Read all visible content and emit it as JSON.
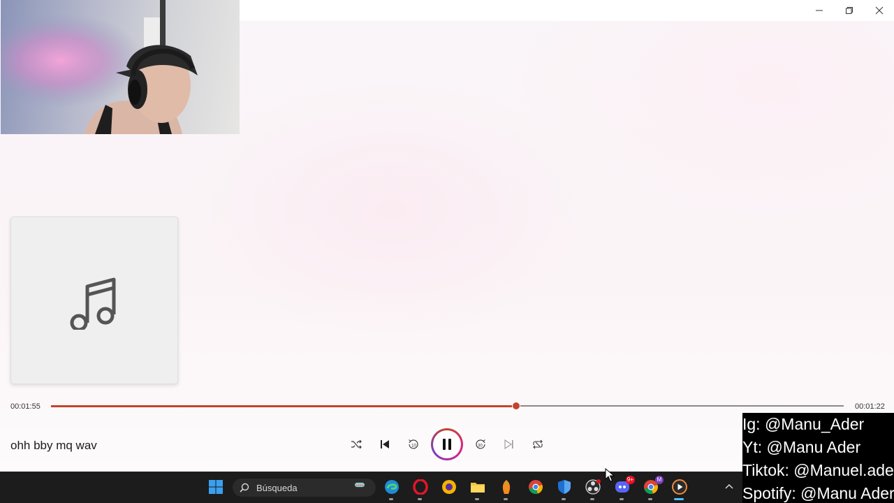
{
  "window": {
    "minimize_icon": "minimize-icon",
    "maximize_icon": "restore-icon",
    "close_icon": "close-icon"
  },
  "player": {
    "album_art_icon": "music-note-icon",
    "time_elapsed": "00:01:55",
    "time_remaining": "00:01:22",
    "progress": 0.587,
    "song_title": "ohh bby mq wav",
    "accent_color": "#c4432b",
    "controls": {
      "shuffle_icon": "shuffle-icon",
      "previous_icon": "previous-icon",
      "rewind_icon": "rewind-10-icon",
      "rewind_label": "10",
      "play_pause_icon": "pause-icon",
      "forward_icon": "forward-30-icon",
      "forward_label": "30",
      "next_icon": "next-icon",
      "repeat_icon": "repeat-icon"
    }
  },
  "overlay": {
    "social_lines": [
      "Ig: @Manu_Ader",
      "Yt: @Manu Ader",
      "Tiktok: @Manuel.ader",
      "Spotify: @Manu Ader"
    ]
  },
  "taskbar": {
    "search_placeholder": "Búsqueda",
    "discord_badge": "9+",
    "chrome_badge": "M",
    "apps": [
      {
        "name": "start",
        "icon": "windows-start-icon"
      },
      {
        "name": "edge",
        "icon": "edge-icon"
      },
      {
        "name": "opera",
        "icon": "opera-icon"
      },
      {
        "name": "authenticator",
        "icon": "shield-key-icon"
      },
      {
        "name": "file-explorer",
        "icon": "folder-icon"
      },
      {
        "name": "fl-studio",
        "icon": "fl-studio-icon"
      },
      {
        "name": "chrome",
        "icon": "chrome-icon"
      },
      {
        "name": "defender",
        "icon": "defender-icon"
      },
      {
        "name": "obs",
        "icon": "obs-icon"
      },
      {
        "name": "discord",
        "icon": "discord-icon"
      },
      {
        "name": "chrome-profile",
        "icon": "chrome-icon"
      },
      {
        "name": "media-player",
        "icon": "media-player-icon"
      }
    ],
    "tray_chevron_icon": "chevron-up-icon"
  }
}
